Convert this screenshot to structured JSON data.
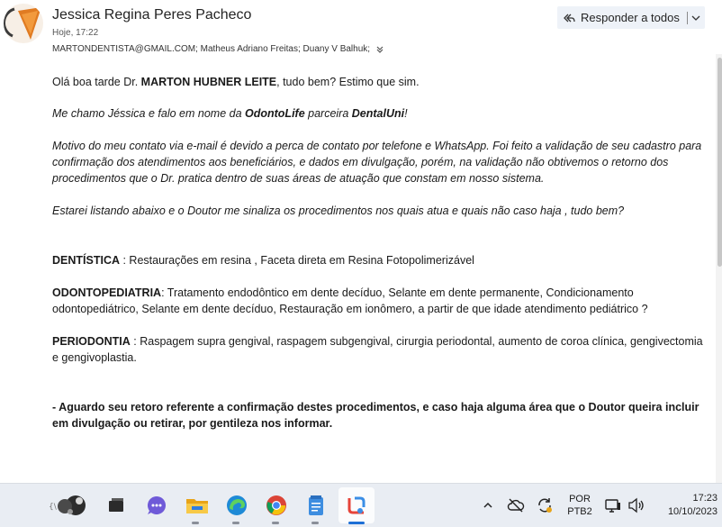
{
  "email": {
    "sender_name": "Jessica Regina Peres Pacheco",
    "date": "Hoje, 17:22",
    "recipients": "MARTONDENTISTA@GMAIL.COM; Matheus Adriano Freitas; Duany V Balhuk;",
    "reply_all_label": "Responder a todos"
  },
  "body": {
    "greeting_prefix": "Olá boa tarde Dr. ",
    "greeting_name": "MARTON HUBNER LEITE",
    "greeting_suffix": ", tudo bem? Estimo que sim.",
    "intro_prefix": "Me chamo Jéssica e falo em nome da ",
    "intro_company": "OdontoLife",
    "intro_middle": " parceira ",
    "intro_partner": "DentalUni",
    "intro_suffix": "!",
    "reason": "Motivo do meu contato via e-mail é devido a perca de contato por telefone e WhatsApp. Foi feito a validação de seu cadastro para confirmação dos atendimentos aos beneficiários,  e dados em divulgação, porém, na validação não obtivemos o retorno dos procedimentos que o Dr. pratica dentro de suas áreas de atuação que constam em nosso sistema.",
    "listing": "Estarei listando abaixo e o Doutor me sinaliza os procedimentos nos quais atua e quais não caso haja , tudo bem?",
    "dentistica_label": "DENTÍSTICA",
    "dentistica_text": " : Restaurações em resina , Faceta direta em Resina Fotopolimerizável",
    "odonto_label": "ODONTOPEDIATRIA",
    "odonto_text": ": Tratamento endodôntico em dente decíduo, Selante em dente permanente, Condicionamento odontopediátrico, Selante em dente decíduo, Restauração em ionômero, a partir de que idade atendimento pediátrico ?",
    "perio_label": "PERIODONTIA",
    "perio_text": " : Raspagem supra gengival, raspagem subgengival, cirurgia periodontal, aumento de coroa clínica, gengivectomia e gengivoplastia.",
    "closing": "- Aguardo seu retoro referente a confirmação destes procedimentos, e caso haja alguma área que o Doutor queira incluir em divulgação ou retirar, por gentileza nos informar."
  },
  "taskbar": {
    "language_top": "POR",
    "language_bottom": "PTB2",
    "time": "17:23",
    "date": "10/10/2023",
    "icons": [
      "widgets-icon",
      "task-view-icon",
      "teams-chat-icon",
      "file-explorer-icon",
      "edge-icon",
      "chrome-icon",
      "notepad-icon",
      "snipping-tool-icon"
    ]
  },
  "colors": {
    "reply_button_bg": "#eef2f8",
    "taskbar_bg": "#e9edf3",
    "avatar_orange": "#e07b22"
  }
}
